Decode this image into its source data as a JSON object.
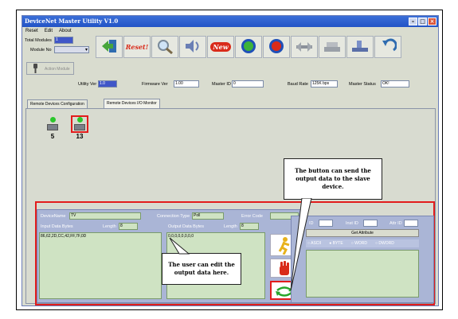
{
  "window": {
    "title": "DeviceNet Master Utility V1.0"
  },
  "menu": [
    "Reset",
    "Edit",
    "About"
  ],
  "top": {
    "total_modules_label": "Total Modules",
    "total_modules_value": "1",
    "module_no_label": "Module No",
    "action_module_label": "Action Module",
    "utility_ver_label": "Utility Ver",
    "utility_ver_value": "1.0",
    "firmware_ver_label": "Firmware Ver",
    "firmware_ver_value": "1.00",
    "master_id_label": "Master ID",
    "master_id_value": "0",
    "baud_rate_label": "Baud Rate",
    "baud_rate_value": "125K bps",
    "master_status_label": "Master Status",
    "master_status_value": "OK!"
  },
  "toolbar": [
    "exit-icon",
    "reset-icon",
    "search-icon",
    "scan-icon",
    "new-icon",
    "start-icon",
    "stop-icon",
    "config-icon",
    "upload-icon",
    "download-icon",
    "undo-icon"
  ],
  "toolbar_reset_label": "Reset!",
  "toolbar_new_label": "New",
  "tabs": [
    "Remote Devices Configuration",
    "Remote Devices I/O Monitor"
  ],
  "devices": [
    {
      "id": "5"
    },
    {
      "id": "13"
    }
  ],
  "detail": {
    "device_name_label": "DeviceName",
    "device_name_value": "TV",
    "connection_type_label": "Connection Type",
    "connection_type_value": "Poll",
    "error_code_label": "Error Code",
    "error_code_value": "",
    "input_label": "Input Data Bytes",
    "input_length_label": "Length",
    "input_length_value": "8",
    "output_label": "Output Data Bytes",
    "output_length_label": "Length",
    "output_length_value": "8",
    "input_data": "86,62,2D,CC,42,FF,7F,0D",
    "output_data": "0,0,0,0,0,0,0,0",
    "id_label": "ID",
    "inst_id_label": "Inst ID",
    "attr_id_label": "Attr ID",
    "get_attribute_label": "Get Attribute",
    "radio_options": [
      "ASCII",
      "BYTE",
      "WORD",
      "DWORD"
    ],
    "selected_radio": "BYTE"
  },
  "callouts": {
    "send": "The button can send the output data to the slave device.",
    "edit": "The user can edit the output data here."
  }
}
